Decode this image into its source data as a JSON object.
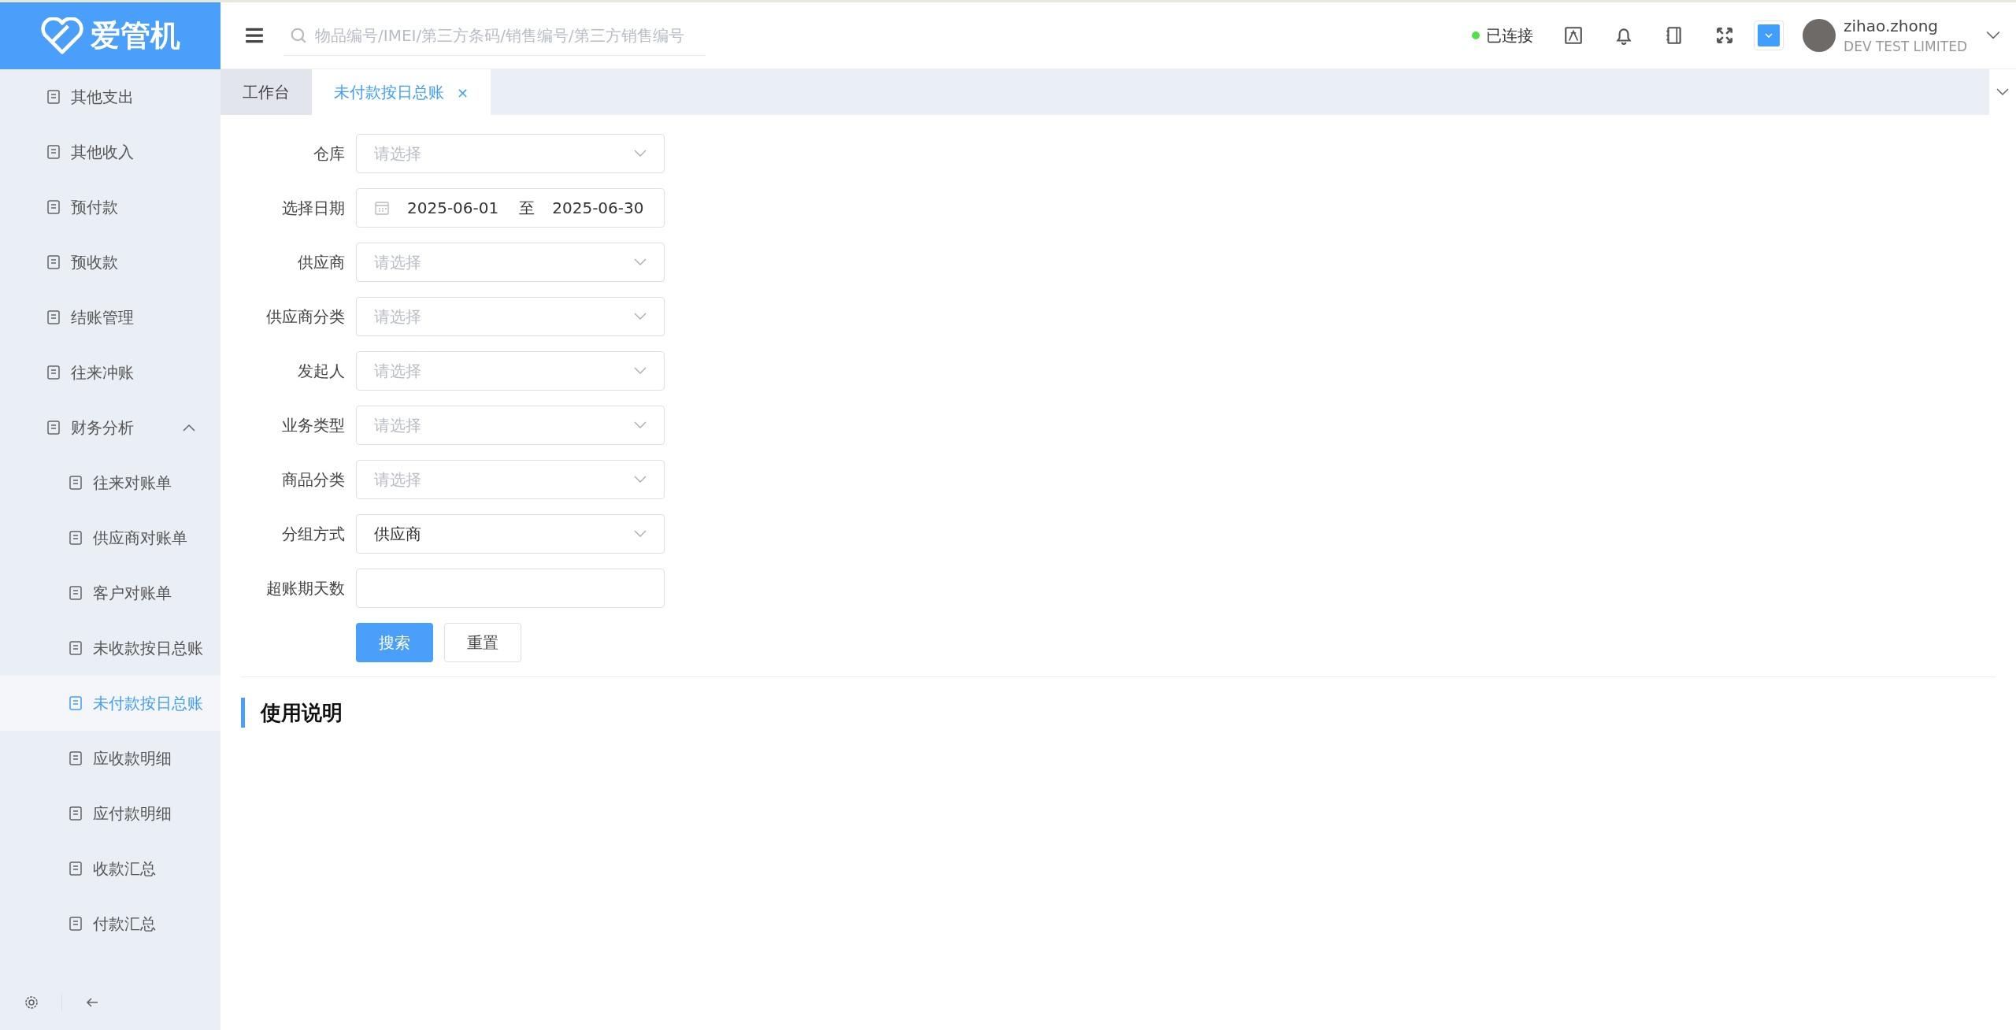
{
  "logo": {
    "text": "爱管机"
  },
  "sidebar": {
    "items": [
      {
        "label": "其他支出",
        "selected": false
      },
      {
        "label": "其他收入",
        "selected": false
      },
      {
        "label": "预付款",
        "selected": false
      },
      {
        "label": "预收款",
        "selected": false
      },
      {
        "label": "结账管理",
        "selected": false
      },
      {
        "label": "往来冲账",
        "selected": false
      },
      {
        "label": "财务分析",
        "selected": false,
        "expanded": true,
        "children": [
          {
            "label": "往来对账单",
            "selected": false
          },
          {
            "label": "供应商对账单",
            "selected": false
          },
          {
            "label": "客户对账单",
            "selected": false
          },
          {
            "label": "未收款按日总账",
            "selected": false
          },
          {
            "label": "未付款按日总账",
            "selected": true
          },
          {
            "label": "应收款明细",
            "selected": false
          },
          {
            "label": "应付款明细",
            "selected": false
          },
          {
            "label": "收款汇总",
            "selected": false
          },
          {
            "label": "付款汇总",
            "selected": false
          }
        ]
      }
    ]
  },
  "header": {
    "search": {
      "placeholder": "物品编号/IMEI/第三方条码/销售编号/第三方销售编号"
    },
    "connection": {
      "label": "已连接"
    },
    "user": {
      "name": "zihao.zhong",
      "company": "DEV TEST LIMITED"
    }
  },
  "tabs": [
    {
      "label": "工作台",
      "selected": false
    },
    {
      "label": "未付款按日总账",
      "selected": true,
      "close": "×"
    }
  ],
  "form": {
    "fields": [
      {
        "label": "仓库",
        "kind": "select",
        "placeholder": "请选择"
      },
      {
        "label": "选择日期",
        "kind": "daterange",
        "start": "2025-06-01",
        "separator": "至",
        "end": "2025-06-30"
      },
      {
        "label": "供应商",
        "kind": "select",
        "placeholder": "请选择"
      },
      {
        "label": "供应商分类",
        "kind": "select",
        "placeholder": "请选择"
      },
      {
        "label": "发起人",
        "kind": "select",
        "placeholder": "请选择"
      },
      {
        "label": "业务类型",
        "kind": "select",
        "placeholder": "请选择"
      },
      {
        "label": "商品分类",
        "kind": "select",
        "placeholder": "请选择"
      },
      {
        "label": "分组方式",
        "kind": "select",
        "value": "供应商"
      },
      {
        "label": "超账期天数",
        "kind": "input"
      }
    ],
    "buttons": [
      {
        "label": "搜索",
        "kind": "primary"
      },
      {
        "label": "重置",
        "kind": "default"
      }
    ]
  },
  "section": {
    "title": "使用说明"
  }
}
